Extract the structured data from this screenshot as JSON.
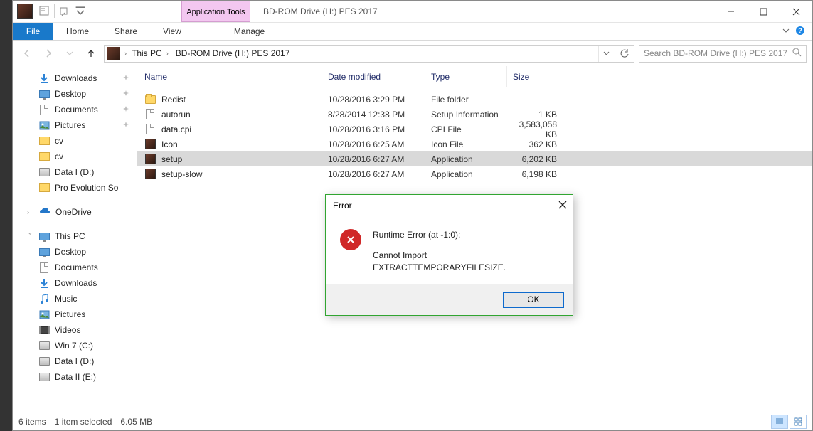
{
  "titlebar": {
    "contextual_tab": "Application Tools",
    "contextual_sub": "Manage",
    "window_title": "BD-ROM Drive (H:) PES 2017"
  },
  "ribbon": {
    "file": "File",
    "tabs": [
      "Home",
      "Share",
      "View"
    ],
    "manage": "Manage"
  },
  "breadcrumb": {
    "items": [
      "This PC",
      "BD-ROM Drive (H:) PES 2017"
    ]
  },
  "search": {
    "placeholder": "Search BD-ROM Drive (H:) PES 2017"
  },
  "nav": {
    "quick": [
      {
        "label": "Downloads",
        "icon": "downloads",
        "pinned": true
      },
      {
        "label": "Desktop",
        "icon": "desktop",
        "pinned": true
      },
      {
        "label": "Documents",
        "icon": "documents",
        "pinned": true
      },
      {
        "label": "Pictures",
        "icon": "pictures",
        "pinned": true
      },
      {
        "label": "cv",
        "icon": "folder",
        "pinned": false
      },
      {
        "label": "cv",
        "icon": "folder",
        "pinned": false
      },
      {
        "label": "Data I (D:)",
        "icon": "disk",
        "pinned": false
      },
      {
        "label": "Pro Evolution So",
        "icon": "folder",
        "pinned": false
      }
    ],
    "onedrive": "OneDrive",
    "thispc_label": "This PC",
    "thispc": [
      {
        "label": "Desktop",
        "icon": "desktop"
      },
      {
        "label": "Documents",
        "icon": "documents"
      },
      {
        "label": "Downloads",
        "icon": "downloads"
      },
      {
        "label": "Music",
        "icon": "music"
      },
      {
        "label": "Pictures",
        "icon": "pictures"
      },
      {
        "label": "Videos",
        "icon": "videos"
      },
      {
        "label": "Win 7 (C:)",
        "icon": "disk-win"
      },
      {
        "label": "Data I (D:)",
        "icon": "disk"
      },
      {
        "label": "Data II (E:)",
        "icon": "disk"
      }
    ]
  },
  "columns": {
    "name": "Name",
    "date": "Date modified",
    "type": "Type",
    "size": "Size"
  },
  "files": [
    {
      "name": "Redist",
      "date": "10/28/2016 3:29 PM",
      "type": "File folder",
      "size": "",
      "icon": "folder",
      "selected": false
    },
    {
      "name": "autorun",
      "date": "8/28/2014 12:38 PM",
      "type": "Setup Information",
      "size": "1 KB",
      "icon": "file",
      "selected": false
    },
    {
      "name": "data.cpi",
      "date": "10/28/2016 3:16 PM",
      "type": "CPI File",
      "size": "3,583,058 KB",
      "icon": "file",
      "selected": false
    },
    {
      "name": "Icon",
      "date": "10/28/2016 6:25 AM",
      "type": "Icon File",
      "size": "362 KB",
      "icon": "exe",
      "selected": false
    },
    {
      "name": "setup",
      "date": "10/28/2016 6:27 AM",
      "type": "Application",
      "size": "6,202 KB",
      "icon": "exe",
      "selected": true
    },
    {
      "name": "setup-slow",
      "date": "10/28/2016 6:27 AM",
      "type": "Application",
      "size": "6,198 KB",
      "icon": "exe",
      "selected": false
    }
  ],
  "status": {
    "count": "6 items",
    "selected": "1 item selected",
    "size": "6.05 MB"
  },
  "dialog": {
    "title": "Error",
    "line1": "Runtime Error (at -1:0):",
    "line2": "Cannot Import EXTRACTTEMPORARYFILESIZE.",
    "ok": "OK"
  }
}
